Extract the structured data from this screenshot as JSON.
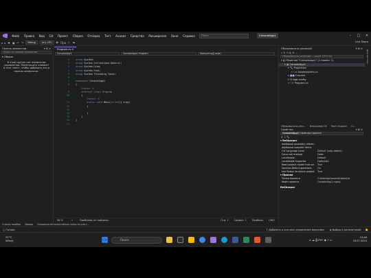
{
  "titlebar": {
    "menu": [
      "Файл",
      "Правка",
      "Вид",
      "Git",
      "Проект",
      "Сборка",
      "Отладка",
      "Тест",
      "Анализ",
      "Средства",
      "Расширения",
      "Окно",
      "Справка"
    ],
    "search_placeholder": "Поиск",
    "project_button": "ConsoleApp1"
  },
  "toolbar": {
    "config": "Debug",
    "platform": "Any CPU",
    "start_label": "Про",
    "live_share": "Live Share"
  },
  "toolbox": {
    "title": "Панель элементов",
    "search_placeholder": "Поиск по панели элементов",
    "group": "Общие",
    "message": "В этой группе нет элементов управления. Перетащите элемент в этот текст, чтобы добавить его в панель элементов."
  },
  "editor": {
    "tab": "Program.cs",
    "nav_project": "ConsoleApp1",
    "nav_class": "ConsoleApp1.Program",
    "nav_member": "Main(string[] args)",
    "lines": [
      {
        "n": "1",
        "segs": [
          [
            "k",
            "using "
          ],
          [
            "",
            "System;"
          ]
        ]
      },
      {
        "n": "2",
        "segs": [
          [
            "k",
            "using "
          ],
          [
            "",
            "System.Collections.Generic;"
          ]
        ]
      },
      {
        "n": "3",
        "segs": [
          [
            "k",
            "using "
          ],
          [
            "",
            "System.Linq;"
          ]
        ]
      },
      {
        "n": "4",
        "segs": [
          [
            "k",
            "using "
          ],
          [
            "",
            "System.Text;"
          ]
        ]
      },
      {
        "n": "5",
        "segs": [
          [
            "k",
            "using "
          ],
          [
            "",
            "System.Threading.Tasks;"
          ]
        ]
      },
      {
        "n": "6",
        "segs": []
      },
      {
        "n": "7",
        "segs": [
          [
            "k",
            "namespace "
          ],
          [
            "",
            "ConsoleApp1"
          ]
        ]
      },
      {
        "n": "8",
        "segs": [
          [
            "",
            "{"
          ]
        ]
      },
      {
        "n": "",
        "segs": [
          [
            "g",
            "    Ссылок: 0"
          ]
        ]
      },
      {
        "n": "9",
        "segs": [
          [
            "",
            "    "
          ],
          [
            "k",
            "internal class "
          ],
          [
            "t",
            "Program"
          ]
        ]
      },
      {
        "n": "10",
        "segs": [
          [
            "",
            "    {"
          ]
        ]
      },
      {
        "n": "",
        "segs": [
          [
            "g",
            "        Ссылок: 0"
          ]
        ]
      },
      {
        "n": "11",
        "segs": [
          [
            "",
            "        "
          ],
          [
            "k",
            "static void "
          ],
          [
            "m",
            "Main"
          ],
          [
            "",
            "("
          ],
          [
            "k",
            "string"
          ],
          [
            "",
            "[] args)"
          ]
        ]
      },
      {
        "n": "12",
        "segs": [
          [
            "",
            "        {"
          ]
        ]
      },
      {
        "n": "13",
        "segs": []
      },
      {
        "n": "14",
        "segs": [
          [
            "",
            "        }"
          ]
        ]
      },
      {
        "n": "15",
        "segs": [
          [
            "",
            "    }"
          ]
        ]
      },
      {
        "n": "16",
        "segs": [
          [
            "",
            "}"
          ]
        ]
      },
      {
        "n": "17",
        "segs": []
      }
    ],
    "status": {
      "zoom": "98 %",
      "issues": "Проблемы не найдены.",
      "line": "Стр: 1",
      "col": "Символ: 1",
      "spaces": "Пробелы",
      "eol": "CRLF"
    }
  },
  "solution_explorer": {
    "title": "Обозреватель решений",
    "search_placeholder": "Обозреватель решений — поиск (Ctrl+ж)",
    "items": [
      {
        "label": "Решение \"ConsoleApp1\" (1 проект 1)",
        "indent": 0,
        "selected": false
      },
      {
        "label": "ConsoleApp1",
        "indent": 1,
        "selected": true
      },
      {
        "label": "Properties",
        "indent": 2,
        "selected": false
      },
      {
        "label": "AssemblyInfo.cs",
        "indent": 3,
        "selected": false
      },
      {
        "label": "Ссылки",
        "indent": 2,
        "selected": false
      },
      {
        "label": "App.config",
        "indent": 2,
        "selected": false
      },
      {
        "label": "Program.cs",
        "indent": 2,
        "selected": false
      }
    ],
    "tabs": [
      "Обозреватель реш...",
      "Изменения Git",
      "Team Explorer",
      "Cl..."
    ]
  },
  "properties": {
    "title": "Свойства",
    "object": "ConsoleApp1",
    "object_desc": "Свойства проекта",
    "category1": "ReSharper",
    "rows1": [
      [
        "Additional assembly referen",
        ""
      ],
      [
        "Additional compiler items",
        ""
      ],
      [
        "C# Language Level",
        "Default (auto-detect)"
      ],
      [
        "Force call method",
        "False"
      ],
      [
        "Localizable",
        "Default"
      ],
      [
        "Localizable Inspector",
        "Optimistic"
      ],
      [
        "Read project model from pe",
        "True"
      ],
      [
        "Solution-Wide Inspections",
        "On"
      ],
      [
        "Use Roslyn to obtain project",
        "True"
      ]
    ],
    "category2": "Прочее",
    "rows2": [
      [
        "Папка проекта",
        "C:\\Users\\gr\\source\\repos\\Co"
      ],
      [
        "Файл проекта",
        "ConsoleApp1.csproj"
      ]
    ],
    "footer": "ReSharper"
  },
  "right_strip": "Диагностика",
  "bottom_tabs": [
    "Список ошибок",
    "Вывод",
    "Операции интерактивных средств для L..."
  ],
  "statusbar": {
    "ready": "Готово",
    "source_control": "Добавить в систему управления версиями",
    "repo": "Выбрать репозиторий"
  },
  "taskbar": {
    "temp": "22°C",
    "condition": "Windy",
    "search": "Поиск",
    "lang": "РУС",
    "time": "15:46",
    "date": "18.07.2023"
  }
}
